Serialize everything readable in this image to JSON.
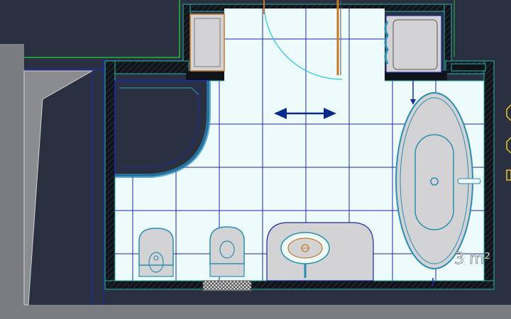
{
  "app": {
    "background_color": "#2b3040",
    "floor_color": "#eefbfd",
    "tile_line_color": "#1b2aa0",
    "wall_hatch_color": "#101318",
    "wall_outline_color": "#1fb8b0",
    "fixture_fill_color": "#d3d3d6",
    "fixture_outline_color": "#2a8eb0",
    "door_swing_color": "#22c8e0",
    "door_color": "#c87828",
    "arrow_color": "#0a2a8a",
    "grey_wall_color": "#7a7c80",
    "annotation_color": "#e8c830"
  },
  "plan": {
    "area_label": "3 m²",
    "arrow_icon": "double-arrow-icon",
    "fixtures": [
      "bathtub",
      "shower",
      "sink",
      "toilet",
      "bidet",
      "cabinet"
    ]
  }
}
